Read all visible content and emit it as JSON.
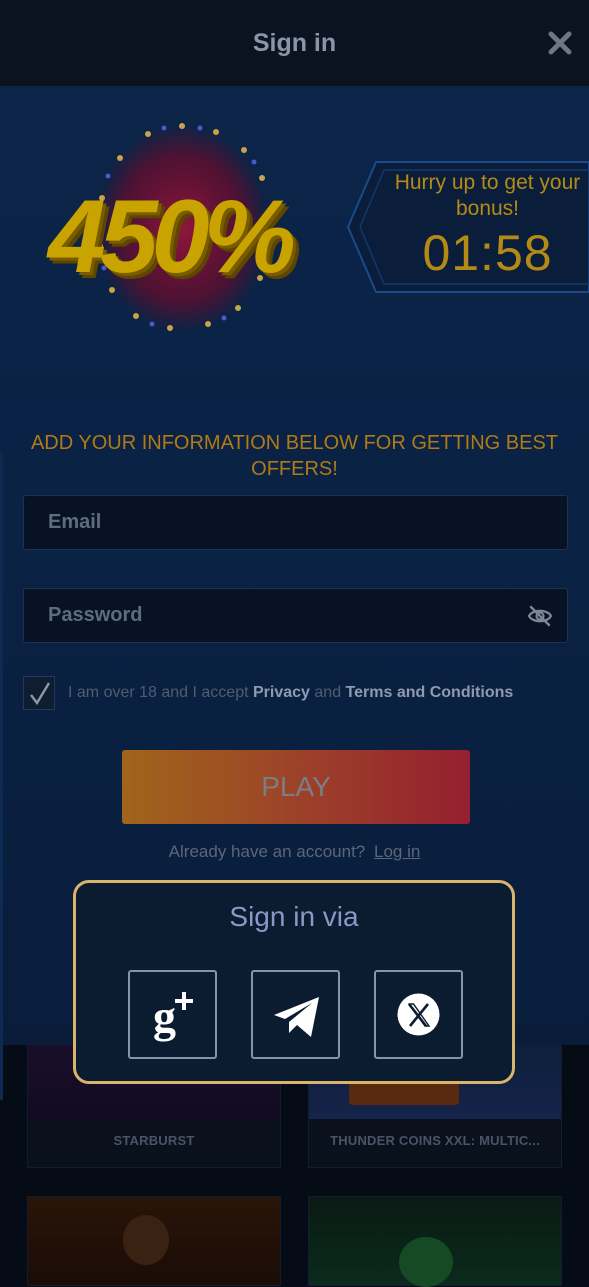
{
  "header": {
    "title": "Sign in",
    "close_icon": "close-icon"
  },
  "promo": {
    "bonus": "450%",
    "timer_label": "Hurry up to get your bonus!",
    "timer_value": "01:58"
  },
  "form": {
    "info_text": "ADD YOUR INFORMATION BELOW FOR GETTING BEST OFFERS!",
    "email_placeholder": "Email",
    "password_placeholder": "Password",
    "password_toggle_icon": "eye-off-icon",
    "agree_checked": true,
    "agree_prefix": "I am over 18 and I accept",
    "privacy_link": "Privacy",
    "agree_and": "and",
    "terms_link": "Terms and Conditions",
    "play_label": "PLAY",
    "already_text": "Already have an account?",
    "login_link": "Log in"
  },
  "sign_in_via": {
    "title": "Sign in via",
    "providers": [
      {
        "name": "Google+",
        "icon": "google-plus-icon"
      },
      {
        "name": "Telegram",
        "icon": "telegram-icon"
      },
      {
        "name": "X",
        "icon": "x-logo-icon"
      }
    ]
  },
  "background_games": [
    {
      "title": "STARBURST"
    },
    {
      "title": "THUNDER COINS XXL: MULTIC..."
    }
  ],
  "colors": {
    "accent_gold": "#b07a16",
    "popup_border": "#d8b56a",
    "play_gradient_start": "#a0651a",
    "play_gradient_end": "#951f2e"
  }
}
